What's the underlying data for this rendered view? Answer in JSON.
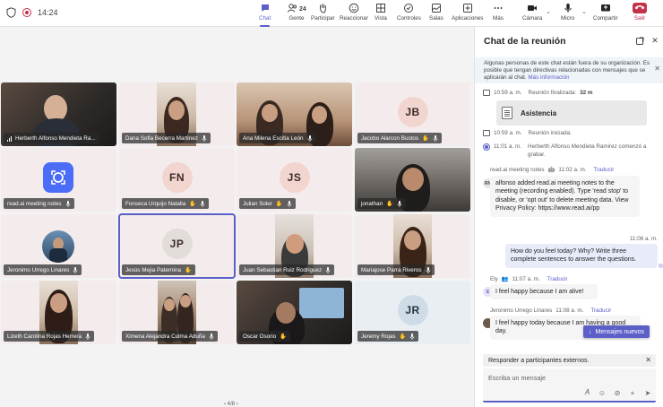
{
  "status": {
    "time": "14:24"
  },
  "toolbar": {
    "chat": "Chat",
    "people": "Gente",
    "people_count": "24",
    "raise": "Participar",
    "react": "Reaccionar",
    "view": "Vista",
    "controls": "Controles",
    "rooms": "Salas",
    "apps": "Aplicaciones",
    "more": "Más",
    "camera": "Cámara",
    "mic": "Micro",
    "share": "Compartir",
    "leave": "Salir"
  },
  "participants": [
    {
      "name": "Herberth Alfonso Mendieta Ra..."
    },
    {
      "name": "Dana Sofia Becerra Martinez"
    },
    {
      "name": "Ana Milena Escitia León"
    },
    {
      "name": "Jacobo Alarcon Bustos",
      "initials": "JB"
    },
    {
      "name": "read.ai meeting notes"
    },
    {
      "name": "Fonseca Urquijo Natalia",
      "initials": "FN"
    },
    {
      "name": "Julian Soler",
      "initials": "JS"
    },
    {
      "name": "jonathan"
    },
    {
      "name": "Jeronimo Urrego Linares"
    },
    {
      "name": "Jesús Mejia Paternina",
      "initials": "JP"
    },
    {
      "name": "Juan Sebastian Ruiz Rodriguez"
    },
    {
      "name": "Mariajose Parra Riveros"
    },
    {
      "name": "Lizeth Carolina Rojas Herrera"
    },
    {
      "name": "Ximena Alejandra Culma Aduña"
    },
    {
      "name": "Oscar Osorio"
    },
    {
      "name": "Jeremy Rojas",
      "initials": "JR"
    }
  ],
  "pager": "4/8",
  "chat": {
    "title": "Chat de la reunión",
    "notice": "Algunas personas de este chat están fuera de su organización. Es posible que tengan directivas relacionadas con mensajes que se aplicarán al chat.",
    "notice_link": "Más información",
    "sys1_time": "10:59 a. m.",
    "sys1_text": "Reunión finalizada:",
    "sys1_value": "32 m",
    "card_title": "Asistencia",
    "sys2_time": "10:59 a. m.",
    "sys2_text": "Reunión iniciada:",
    "sys3_time": "11:01 a. m.",
    "sys3_text": "Herberth Alfonso Mendieta Ramirez comenzó a grabar.",
    "msg1_sender": "read.ai meeting notes",
    "msg1_time": "11:02 a. m.",
    "translate": "Traducir",
    "msg1_avatar": "RN",
    "msg1_text": "alfonso added read.ai meeting notes to the meeting (recording enabled). Type 'read stop' to disable, or 'opt out' to delete meeting data. View Privacy Policy: https://www.read.ai/pp",
    "mine_time": "11:06 a. m.",
    "mine_text": "How do you feel today? Why? Write three complete sentences to answer the questions.",
    "msg2_sender": "Ely",
    "msg2_time": "11:07 a. m.",
    "msg2_avatar": "E",
    "msg2_text": "I feel happy because I am alive!",
    "msg3_sender": "Jeronimo Urrego Linares",
    "msg3_time": "11:08 a. m.",
    "msg3_text": "I feel happy today because I am having a good day.",
    "new_messages": "Mensajes nuevos",
    "reply_to": "Responder a participantes externos.",
    "composer_placeholder": "Escriba un mensaje"
  }
}
